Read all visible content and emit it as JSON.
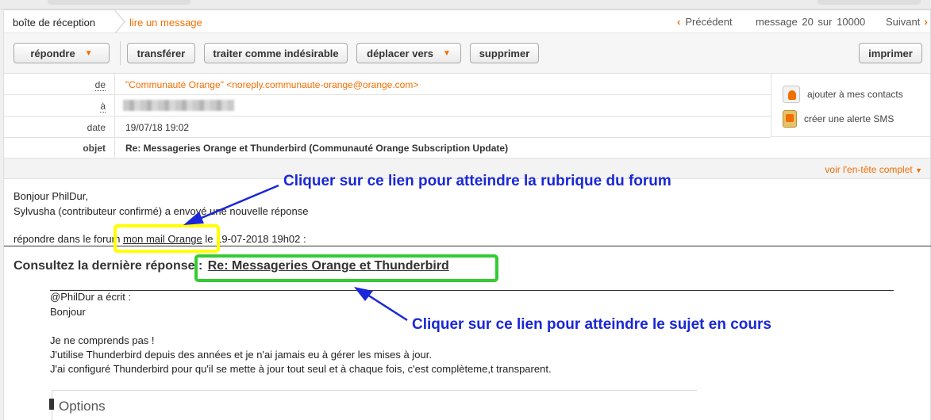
{
  "breadcrumb": {
    "home": "boîte de réception",
    "current": "lire un message"
  },
  "nav": {
    "prev": "Précédent",
    "counter": "message  20  sur  10000",
    "next": "Suivant"
  },
  "toolbar": {
    "reply": "répondre",
    "forward": "transférer",
    "spam": "traiter comme indésirable",
    "move": "déplacer vers",
    "delete": "supprimer",
    "print": "imprimer"
  },
  "headers": {
    "from_label": "de",
    "from_value": "\"Communauté Orange\" <noreply.communaute-orange@orange.com>",
    "to_label": "à",
    "date_label": "date",
    "date_value": "19/07/18 19:02",
    "subject_label": "objet",
    "subject_value": "Re: Messageries Orange et Thunderbird (Communauté Orange Subscription Update)",
    "add_contact": "ajouter à mes contacts",
    "sms_alert": "créer une alerte SMS",
    "full_header": "voir l'en-tête complet"
  },
  "body": {
    "greeting": "Bonjour PhilDur,",
    "line2": "Sylvusha (contributeur confirmé) a envoyé une nouvelle réponse",
    "forum_prefix": "répondre dans le forum",
    "forum_link": "mon mail Orange",
    "forum_suffix": "le 19-07-2018 19h02 :",
    "consult_label": "Consultez la dernière réponse :",
    "consult_link": "Re: Messageries Orange et Thunderbird",
    "quote_author": "@PhilDur  a écrit :",
    "quote_hello": "Bonjour",
    "quote_l1": "Je ne comprends pas !",
    "quote_l2": "J'utilise Thunderbird depuis des années et je n'ai jamais eu à gérer les mises à jour.",
    "quote_l3": "J'ai configuré Thunderbird pour qu'il se mette à jour tout seul et à chaque fois, c'est complèteme,t transparent.",
    "options_title": "Options"
  },
  "annotations": {
    "forum": "Cliquer sur ce lien pour atteindre la rubrique du forum",
    "topic": "Cliquer sur ce lien pour atteindre le sujet en cours"
  },
  "colors": {
    "brand_orange": "#f16e00",
    "annotation_blue": "#1a27d6",
    "highlight_yellow": "#ffff00",
    "highlight_green": "#33cc33"
  }
}
